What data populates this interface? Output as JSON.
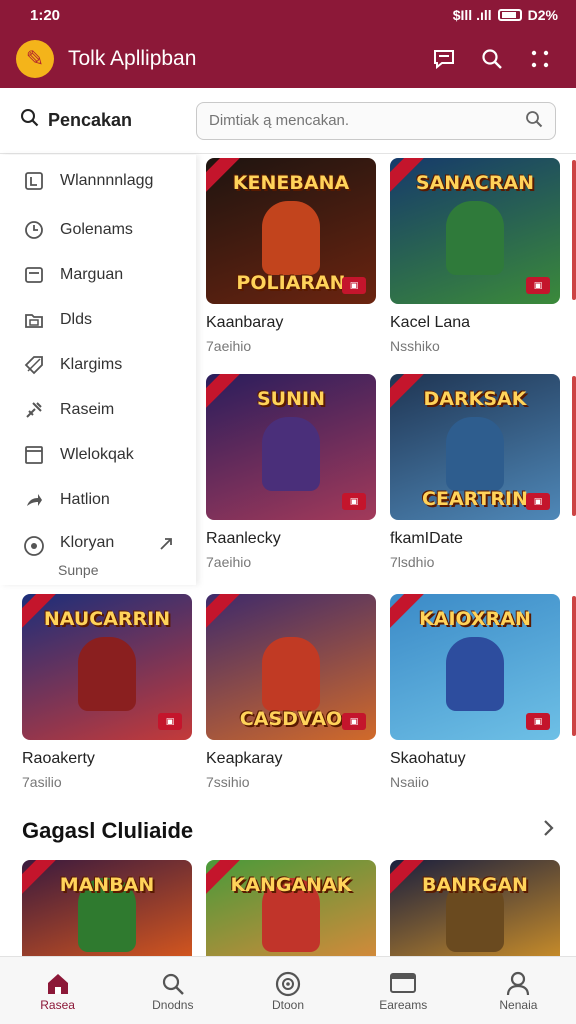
{
  "status": {
    "time": "1:20",
    "signal": "$Ill .ıll",
    "battery": "D2%"
  },
  "app": {
    "title": "Tolk Apllipban"
  },
  "search": {
    "label": "Pencakan",
    "placeholder": "Dimtiak ą mencakan."
  },
  "sidebar": {
    "items": [
      {
        "label": "Wlannnnlagg",
        "icon": "book-icon"
      },
      {
        "label": "Golenams",
        "icon": "clock-icon"
      },
      {
        "label": "Marguan",
        "icon": "card-icon"
      },
      {
        "label": "Dlds",
        "icon": "folder-icon"
      },
      {
        "label": "Klargims",
        "icon": "tag-icon"
      },
      {
        "label": "Raseim",
        "icon": "tools-icon"
      },
      {
        "label": "Wlelokqak",
        "icon": "window-icon"
      },
      {
        "label": "Hatlion",
        "icon": "share-icon"
      }
    ],
    "last": {
      "label": "Kloryan",
      "sub": "Sunpe",
      "icon": "target-icon"
    }
  },
  "cards": [
    {
      "title": "Kaanbaray",
      "sub": "7aeihio",
      "banner_top": "KENEBANA",
      "banner_bottom": "POLIARAN",
      "bg1": "#1e1410",
      "bg2": "#6b2410",
      "hero": "#c2441d"
    },
    {
      "title": "Kacel Lana",
      "sub": "Nsshiko",
      "banner_top": "SANACRAN",
      "banner_bottom": "",
      "bg1": "#163a6b",
      "bg2": "#3b8a3a",
      "hero": "#2f7a3a"
    },
    {
      "title": "Raanlecky",
      "sub": "7aeihio",
      "banner_top": "SUNIN",
      "banner_bottom": "",
      "bg1": "#2a1d5c",
      "bg2": "#a33a5a",
      "hero": "#4a2f7a"
    },
    {
      "title": "fkamIDate",
      "sub": "7lsdhio",
      "banner_top": "DARKSAK",
      "banner_bottom": "CEARTRIN",
      "bg1": "#1f3553",
      "bg2": "#4f88b8",
      "hero": "#2e5d8e"
    },
    {
      "title": "Raoakerty",
      "sub": "7asilio",
      "banner_top": "NAUCARRIN",
      "banner_bottom": "",
      "bg1": "#1c2e7a",
      "bg2": "#c43a3a",
      "hero": "#8a1f1f"
    },
    {
      "title": "Keapkaray",
      "sub": "7ssihio",
      "banner_top": "",
      "banner_bottom": "CASDVAO",
      "bg1": "#3e2a6b",
      "bg2": "#d16a2a",
      "hero": "#c13a24"
    },
    {
      "title": "Skaohatuy",
      "sub": "Nsaiio",
      "banner_top": "KAIOXRAN",
      "banner_bottom": "",
      "bg1": "#3b8ac7",
      "bg2": "#6ec0e6",
      "hero": "#2d4d9e"
    },
    {
      "title": "",
      "sub": "",
      "banner_top": "MANBAN",
      "banner_bottom": "",
      "bg1": "#3a1a3e",
      "bg2": "#d1551f",
      "hero": "#2f7a2f"
    },
    {
      "title": "",
      "sub": "",
      "banner_top": "KANGANAK",
      "banner_bottom": "",
      "bg1": "#4a9a3a",
      "bg2": "#d18a3a",
      "hero": "#c1342a"
    },
    {
      "title": "",
      "sub": "",
      "banner_top": "BANRGAN",
      "banner_bottom": "",
      "bg1": "#1a1f3e",
      "bg2": "#c48a2a",
      "hero": "#6a4a1f"
    }
  ],
  "section": {
    "title": "Gagasl Cluliaide"
  },
  "nav": [
    {
      "label": "Rasea",
      "icon": "home-icon",
      "active": true
    },
    {
      "label": "Dnodns",
      "icon": "search-icon",
      "active": false
    },
    {
      "label": "Dtoon",
      "icon": "gamepad-icon",
      "active": false
    },
    {
      "label": "Eareams",
      "icon": "tv-icon",
      "active": false
    },
    {
      "label": "Nenaia",
      "icon": "profile-icon",
      "active": false
    }
  ],
  "colors": {
    "brand": "#8c1838",
    "accent": "#f4b41a"
  }
}
